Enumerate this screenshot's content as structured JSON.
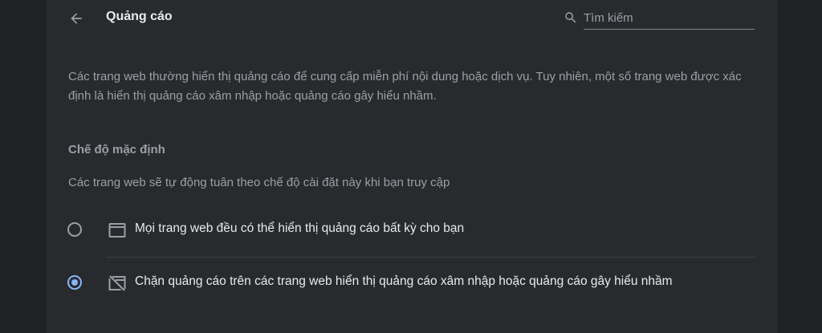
{
  "header": {
    "title": "Quảng cáo",
    "search_placeholder": "Tìm kiếm"
  },
  "description": "Các trang web thường hiển thị quảng cáo để cung cấp miễn phí nội dung hoặc dịch vụ. Tuy nhiên, một số trang web được xác định là hiển thị quảng cáo xâm nhập hoặc quảng cáo gây hiểu nhầm.",
  "default_section": {
    "title": "Chế độ mặc định",
    "subtitle": "Các trang web sẽ tự động tuân theo chế độ cài đặt này khi bạn truy cập"
  },
  "options": [
    {
      "label": "Mọi trang web đều có thể hiển thị quảng cáo bất kỳ cho bạn",
      "icon": "ad-window-icon",
      "selected": false
    },
    {
      "label": "Chặn quảng cáo trên các trang web hiển thị quảng cáo xâm nhập hoặc quảng cáo gây hiểu nhầm",
      "icon": "ad-blocked-icon",
      "selected": true
    }
  ],
  "colors": {
    "background": "#202124",
    "card": "#292a2d",
    "accent": "#8ab4f8",
    "text_primary": "#e8eaed",
    "text_secondary": "#9aa0a6"
  }
}
